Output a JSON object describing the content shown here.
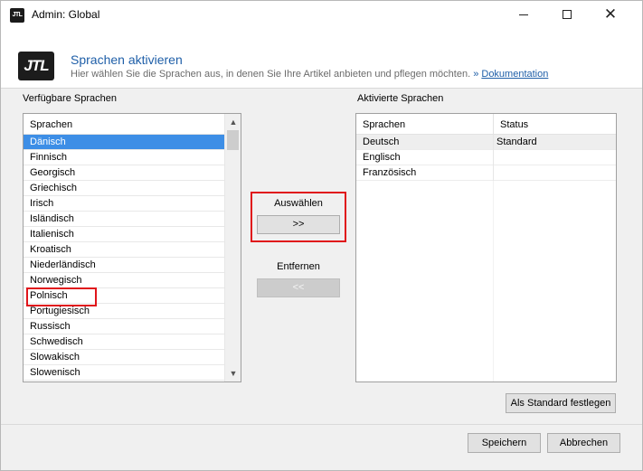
{
  "window": {
    "title": "Admin: Global",
    "app_icon_text": "JTL",
    "close_glyph": "✕"
  },
  "header": {
    "logo_text": "JTL",
    "title": "Sprachen aktivieren",
    "subtitle": "Hier wählen Sie die Sprachen aus, in denen Sie Ihre Artikel anbieten und pflegen möchten.",
    "link_prefix": "»",
    "link_label": "Dokumentation"
  },
  "available": {
    "section_label": "Verfügbare Sprachen",
    "column_header": "Sprachen",
    "items": [
      "Dänisch",
      "Finnisch",
      "Georgisch",
      "Griechisch",
      "Irisch",
      "Isländisch",
      "Italienisch",
      "Kroatisch",
      "Niederländisch",
      "Norwegisch",
      "Polnisch",
      "Portugiesisch",
      "Russisch",
      "Schwedisch",
      "Slowakisch",
      "Slowenisch"
    ],
    "selected_index": 0,
    "scroll_up_glyph": "▲",
    "scroll_down_glyph": "▼"
  },
  "actions": {
    "select_label": "Auswählen",
    "select_button": ">>",
    "remove_label": "Entfernen",
    "remove_button": "<<"
  },
  "activated": {
    "section_label": "Aktivierte Sprachen",
    "col_language": "Sprachen",
    "col_status": "Status",
    "rows": [
      {
        "language": "Deutsch",
        "status": "Standard"
      },
      {
        "language": "Englisch",
        "status": ""
      },
      {
        "language": "Französisch",
        "status": ""
      }
    ]
  },
  "buttons": {
    "set_default": "Als Standard festlegen",
    "save": "Speichern",
    "cancel": "Abbrechen"
  }
}
